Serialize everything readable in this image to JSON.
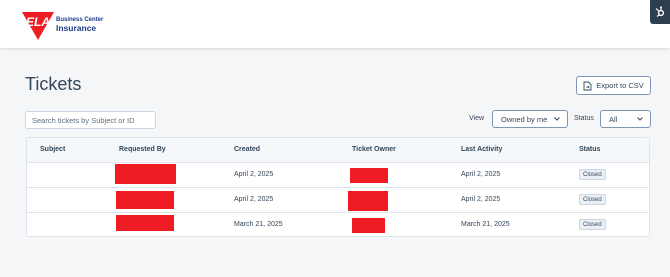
{
  "brand": {
    "logo_text": "ELA",
    "line1": "Business Center",
    "line2": "Insurance"
  },
  "page": {
    "title": "Tickets",
    "export_label": "Export to CSV"
  },
  "filters": {
    "search_placeholder": "Search tickets by Subject or ID",
    "view_label": "View",
    "view_value": "Owned by me",
    "status_label": "Status",
    "status_value": "All"
  },
  "table": {
    "headers": [
      "Subject",
      "Requested By",
      "Created",
      "Ticket Owner",
      "Last Activity",
      "Status"
    ],
    "rows": [
      {
        "subject": "",
        "created": "April 2, 2025",
        "last_activity": "April 2, 2025",
        "status": "Closed"
      },
      {
        "subject": "",
        "created": "April 2, 2025",
        "last_activity": "April 2, 2025",
        "status": "Closed"
      },
      {
        "subject": "",
        "created": "March 21, 2025",
        "last_activity": "March 21, 2025",
        "status": "Closed"
      }
    ]
  },
  "colors": {
    "brand_red": "#ee1d23",
    "brand_blue": "#1d3a8a",
    "text": "#33475b",
    "border": "#dfe3eb"
  },
  "icons": {
    "hub": "hubspot-sprocket-icon",
    "export": "export-file-icon",
    "dropdown": "chevron-down-icon"
  }
}
